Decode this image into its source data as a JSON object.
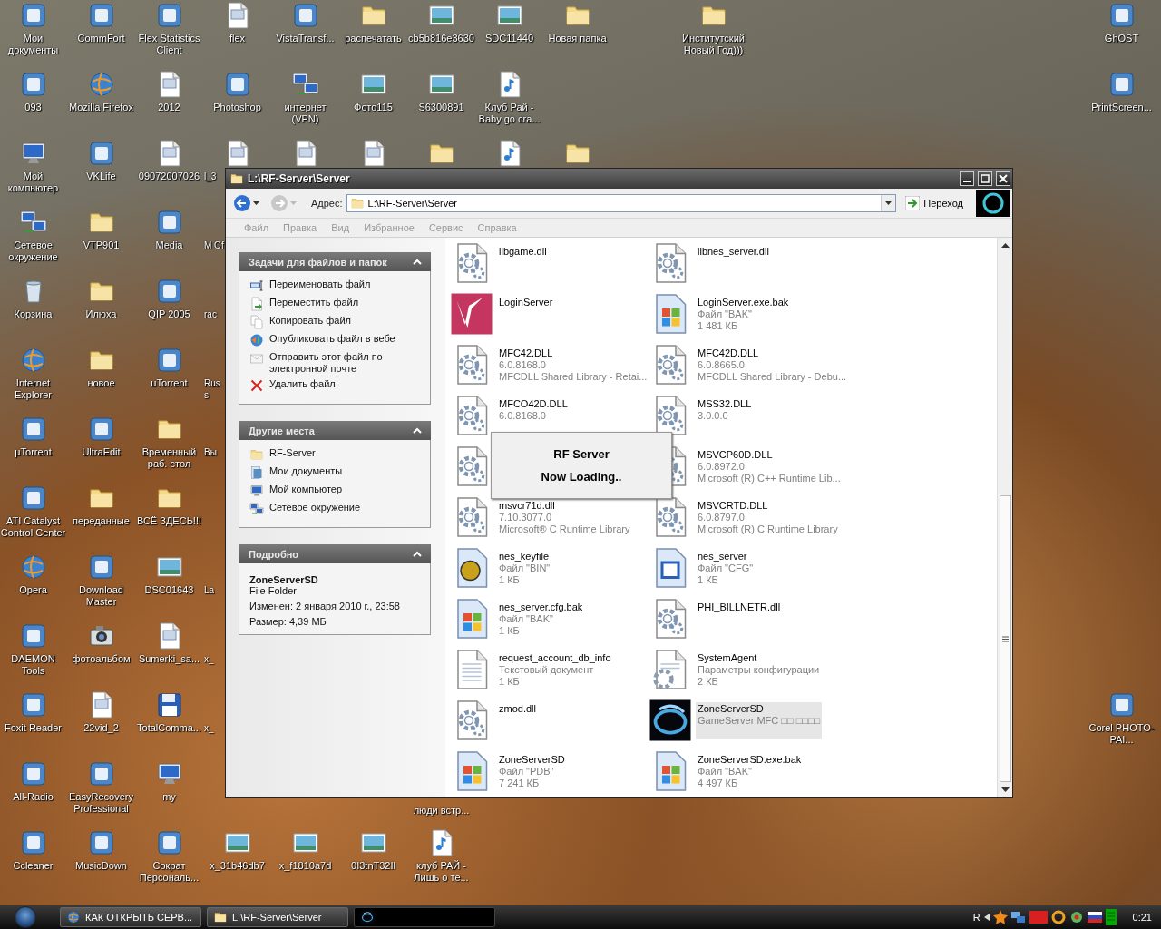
{
  "desktop": {
    "columns": [
      [
        {
          "label": "Мои документы",
          "kind": "app"
        },
        {
          "label": "093",
          "kind": "app"
        },
        {
          "label": "Мой компьютер",
          "kind": "computer"
        },
        {
          "label": "Сетевое окружение",
          "kind": "network"
        },
        {
          "label": "Корзина",
          "kind": "recycle-bin"
        },
        {
          "label": "Internet Explorer",
          "kind": "globe"
        },
        {
          "label": "µTorrent",
          "kind": "app"
        },
        {
          "label": "ATI Catalyst Control Center",
          "kind": "app"
        },
        {
          "label": "Opera",
          "kind": "globe"
        },
        {
          "label": "DAEMON Tools",
          "kind": "app"
        },
        {
          "label": "Foxit Reader",
          "kind": "app"
        },
        {
          "label": "All-Radio",
          "kind": "app"
        },
        {
          "label": "Ccleaner",
          "kind": "app"
        }
      ],
      [
        {
          "label": "CommFort",
          "kind": "app"
        },
        {
          "label": "Mozilla Firefox",
          "kind": "globe"
        },
        {
          "label": "VKLife",
          "kind": "app"
        },
        {
          "label": "VTP901",
          "kind": "folder"
        },
        {
          "label": "Илюха",
          "kind": "folder"
        },
        {
          "label": "новое",
          "kind": "folder"
        },
        {
          "label": "UltraEdit",
          "kind": "app"
        },
        {
          "label": "переданные",
          "kind": "folder"
        },
        {
          "label": "Download Master",
          "kind": "app"
        },
        {
          "label": "фотоальбом",
          "kind": "camera"
        },
        {
          "label": "22vid_2",
          "kind": "media-file"
        },
        {
          "label": "EasyRecovery Professional",
          "kind": "app"
        },
        {
          "label": "MusicDown",
          "kind": "app"
        }
      ],
      [
        {
          "label": "Flex Statistics Client",
          "kind": "app"
        },
        {
          "label": "2012",
          "kind": "media-file"
        },
        {
          "label": "09072007026",
          "kind": "media-file"
        },
        {
          "label": "Media",
          "kind": "app"
        },
        {
          "label": "QIP 2005",
          "kind": "app"
        },
        {
          "label": "uTorrent",
          "kind": "app"
        },
        {
          "label": "Временный раб. стол",
          "kind": "folder"
        },
        {
          "label": "ВСЁ ЗДЕСЬ!!!",
          "kind": "folder"
        },
        {
          "label": "DSC01643",
          "kind": "image"
        },
        {
          "label": "Sumerki_sa...",
          "kind": "media-file"
        },
        {
          "label": "TotalComma...",
          "kind": "floppy"
        },
        {
          "label": "my",
          "kind": "computer"
        },
        {
          "label": "Сократ Персональ...",
          "kind": "app"
        }
      ],
      [
        {
          "label": "flex",
          "kind": "media-file"
        },
        {
          "label": "Photoshop",
          "kind": "app"
        },
        {
          "label": "l_3",
          "kind": "media-file",
          "cut_off": true
        },
        {
          "label": "M Of",
          "cut_off": true
        },
        {
          "label": "rac",
          "cut_off": true
        },
        {
          "label": "Russ",
          "cut_off": true
        },
        {
          "label": "Вы",
          "cut_off": true
        },
        null,
        {
          "label": "La",
          "cut_off": true
        },
        {
          "label": "x_",
          "cut_off": true
        },
        {
          "label": "x_",
          "cut_off": true
        },
        null,
        {
          "label": "x_31b46db7",
          "kind": "image"
        }
      ],
      [
        {
          "label": "VistaTransf...",
          "kind": "app"
        },
        {
          "label": "интернет (VPN)",
          "kind": "network"
        },
        {
          "kind": "media-file"
        },
        null,
        null,
        null,
        null,
        null,
        null,
        null,
        null,
        null,
        {
          "label": "x_f1810a7d",
          "kind": "image"
        }
      ],
      [
        {
          "label": "распечатать",
          "kind": "folder"
        },
        {
          "label": "Фото115",
          "kind": "image"
        },
        {
          "kind": "media-file"
        },
        null,
        null,
        null,
        null,
        null,
        null,
        null,
        null,
        null,
        {
          "label": "0I3tnT32Il",
          "kind": "image"
        }
      ],
      [
        {
          "label": "cb5b816e3630",
          "kind": "image"
        },
        {
          "label": "S6300891",
          "kind": "image"
        },
        {
          "kind": "folder"
        },
        null,
        null,
        null,
        null,
        null,
        null,
        null,
        null,
        {
          "label": "люди встр..."
        },
        {
          "label": "клуб РАЙ - Лишь о те...",
          "kind": "audio-file"
        }
      ],
      [
        {
          "label": "SDC11440",
          "kind": "image"
        },
        {
          "label": "Клуб Рай - Baby go cra...",
          "kind": "audio-file"
        },
        {
          "kind": "audio-file"
        }
      ],
      [
        {
          "label": "Новая папка",
          "kind": "folder"
        },
        null,
        {
          "kind": "folder"
        }
      ],
      null,
      [
        {
          "label": "Институтский Новый Год)))",
          "kind": "folder"
        }
      ],
      null,
      null,
      null,
      null,
      null,
      [
        {
          "label": "GhOST",
          "kind": "app"
        },
        {
          "label": "PrintScreen...",
          "kind": "app"
        },
        null,
        null,
        null,
        null,
        null,
        null,
        null,
        null,
        {
          "label": "Corel PHOTO-PAI...",
          "kind": "app"
        }
      ]
    ]
  },
  "window": {
    "title": "L:\\RF-Server\\Server",
    "address_label": "Адрес:",
    "address": "L:\\RF-Server\\Server",
    "go_button": "Переход",
    "menu": [
      {
        "label": "Файл",
        "disabled": true
      },
      {
        "label": "Правка",
        "disabled": true
      },
      {
        "label": "Вид",
        "disabled": true
      },
      {
        "label": "Избранное",
        "disabled": true
      },
      {
        "label": "Сервис",
        "disabled": true
      },
      {
        "label": "Справка",
        "disabled": true
      }
    ],
    "panels": [
      {
        "title": "Задачи для файлов и папок",
        "expanded": true,
        "items": [
          {
            "label": "Переименовать файл",
            "kind": "rename"
          },
          {
            "label": "Переместить файл",
            "kind": "move"
          },
          {
            "label": "Копировать файл",
            "kind": "copy"
          },
          {
            "label": "Опубликовать файл в вебе",
            "kind": "publish"
          },
          {
            "label": "Отправить этот файл по электронной почте",
            "kind": "email"
          },
          {
            "label": "Удалить файл",
            "kind": "delete"
          }
        ]
      },
      {
        "title": "Другие места",
        "expanded": true,
        "items": [
          {
            "label": "RF-Server",
            "kind": "folder"
          },
          {
            "label": "Мои документы",
            "kind": "documents"
          },
          {
            "label": "Мой компьютер",
            "kind": "computer"
          },
          {
            "label": "Сетевое окружение",
            "kind": "network"
          }
        ]
      },
      {
        "title": "Подробно",
        "expanded": true,
        "name": "ZoneServerSD",
        "lines": [
          "File Folder",
          "Изменен: 2 января 2010 г., 23:58",
          "Размер: 4,39 МБ"
        ]
      }
    ],
    "files": [
      {
        "name": "libgame.dll",
        "kind": "gear-file",
        "selected": false
      },
      {
        "name": "libnes_server.dll",
        "kind": "gear-file",
        "selected": false
      },
      {
        "name": "LoginServer",
        "kind": "rf-logo",
        "selected": false
      },
      {
        "name": "LoginServer.exe.bak",
        "lines": [
          "Файл \"BAK\"",
          "1 481 КБ"
        ],
        "kind": "windows-file",
        "selected": false
      },
      {
        "name": "MFC42.DLL",
        "lines": [
          "6.0.8168.0",
          "MFCDLL Shared Library - Retai..."
        ],
        "kind": "gear-file",
        "selected": false
      },
      {
        "name": "MFC42D.DLL",
        "lines": [
          "6.0.8665.0",
          "MFCDLL Shared Library - Debu..."
        ],
        "kind": "gear-file",
        "selected": false
      },
      {
        "name": "MFCO42D.DLL",
        "lines": [
          "6.0.8168.0"
        ],
        "kind": "gear-file",
        "selected": false
      },
      {
        "name": "MSS32.DLL",
        "lines": [
          "3.0.0.0"
        ],
        "kind": "gear-file",
        "selected": false
      },
      {
        "kind": "gear-file",
        "selected": false
      },
      {
        "name": "MSVCP60D.DLL",
        "lines": [
          "6.0.8972.0",
          "Microsoft (R) C++ Runtime Lib..."
        ],
        "kind": "gear-file",
        "selected": false
      },
      {
        "name": "msvcr71d.dll",
        "lines": [
          "7.10.3077.0",
          "Microsoft® C Runtime Library"
        ],
        "kind": "gear-file",
        "selected": false
      },
      {
        "name": "MSVCRTD.DLL",
        "lines": [
          "6.0.8797.0",
          "Microsoft (R) C Runtime Library"
        ],
        "kind": "gear-file",
        "selected": false
      },
      {
        "name": "nes_keyfile",
        "lines": [
          "Файл \"BIN\"",
          "1 КБ"
        ],
        "kind": "bin-file",
        "selected": false
      },
      {
        "name": "nes_server",
        "lines": [
          "Файл \"CFG\"",
          "1 КБ"
        ],
        "kind": "cfg-file",
        "selected": false
      },
      {
        "name": "nes_server.cfg.bak",
        "lines": [
          "Файл \"BAK\"",
          "1 КБ"
        ],
        "kind": "windows-file",
        "selected": false
      },
      {
        "name": "PHI_BILLNETR.dll",
        "kind": "gear-file",
        "selected": false
      },
      {
        "name": "request_account_db_info",
        "lines": [
          "Текстовый документ",
          "1 КБ"
        ],
        "kind": "text-file",
        "selected": false
      },
      {
        "name": "SystemAgent",
        "lines": [
          "Параметры конфигурации",
          "2 КБ"
        ],
        "kind": "settings-file",
        "selected": false
      },
      {
        "name": "zmod.dll",
        "kind": "gear-file",
        "selected": false
      },
      {
        "name": "ZoneServerSD",
        "lines": [
          "GameServer MFC □□ □□□□"
        ],
        "kind": "rf-dark-logo",
        "selected": true
      },
      {
        "name": "ZoneServerSD",
        "lines": [
          "Файл \"PDB\"",
          "7 241 КБ"
        ],
        "kind": "windows-file",
        "selected": false
      },
      {
        "name": "ZoneServerSD.exe.bak",
        "lines": [
          "Файл \"BAK\"",
          "4 497 КБ"
        ],
        "kind": "windows-file",
        "selected": false
      }
    ],
    "dialog": {
      "title": "RF Server",
      "message": "Now Loading.."
    }
  },
  "taskbar": {
    "buttons": [
      {
        "label": "КАК ОТКРЫТЬ СЕРВ...",
        "kind": "globe",
        "selected": false
      },
      {
        "label": "L:\\RF-Server\\Server",
        "kind": "folder",
        "selected": false
      },
      {
        "kind": "rf-dark-logo",
        "selected": true
      }
    ],
    "tray": {
      "language": "R",
      "clock": "0:21"
    }
  }
}
